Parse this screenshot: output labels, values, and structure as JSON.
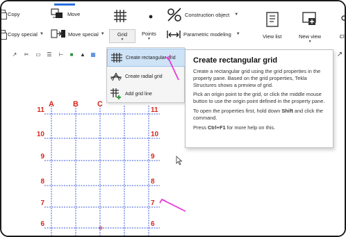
{
  "ribbon": {
    "copy_label": "Copy",
    "copy_special_label": "Copy special",
    "move_label": "Move",
    "move_special_label": "Move special",
    "grid_label": "Grid",
    "points_label": "Points",
    "construction_object_label": "Construction object",
    "parametric_modeling_label": "Parametric modeling",
    "view_list_label": "View list",
    "new_view_label": "New view",
    "clip_label": "Cli"
  },
  "grid_menu": {
    "items": [
      {
        "label": "Create rectangular grid",
        "icon": "rectangular-grid-icon",
        "active": true
      },
      {
        "label": "Create radial grid",
        "icon": "radial-grid-icon",
        "active": false
      },
      {
        "label": "Add grid line",
        "icon": "add-grid-line-icon",
        "active": false
      }
    ]
  },
  "tooltip": {
    "title": "Create rectangular grid",
    "p1": "Create a rectangular grid using the grid properties in the property pane. Based on the grid properties, Tekla Structures shows a preview of grid.",
    "p2": "Pick an origin point to the grid, or click the middle mouse button to use the origin point defined in the property pane.",
    "p3_a": "To open the properties first, hold down ",
    "p3_key": "Shift",
    "p3_b": " and click the command.",
    "p4_a": "Press ",
    "p4_key": "Ctrl+F1",
    "p4_b": " for more help on this."
  },
  "grid": {
    "columns": [
      "A",
      "B",
      "C"
    ],
    "rows": [
      "11",
      "10",
      "9",
      "8",
      "7",
      "6"
    ],
    "label_color": "#d8271c",
    "line_color": "#3d5bd9"
  },
  "colors": {
    "accent": "#2a6fdb",
    "arrow": "#e83ad8",
    "menu_highlight": "#cfe3f7"
  }
}
